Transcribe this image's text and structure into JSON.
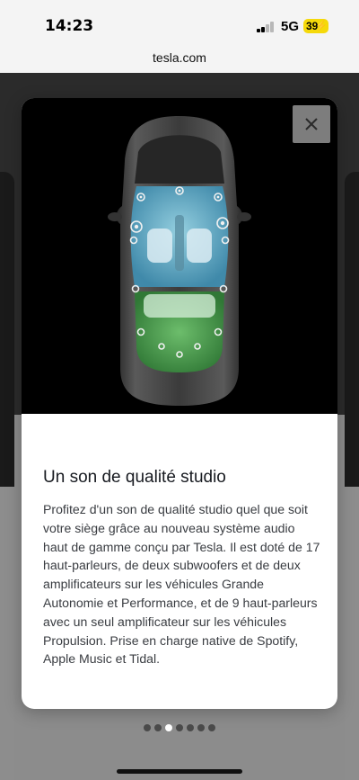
{
  "status_bar": {
    "time": "14:23",
    "network": "5G",
    "battery_level": "39",
    "signal_bars_active": 2
  },
  "browser": {
    "url": "tesla.com"
  },
  "modal": {
    "close_icon": "close-icon",
    "title": "Un son de qualité studio",
    "body": "Profitez d'un son de qualité studio quel que soit votre siège grâce au nouveau système audio haut de gamme conçu par Tesla. Il est doté de 17 haut-parleurs, de deux subwoofers et de deux amplificateurs sur les véhicules Grande Autonomie et Performance, et de 9 haut-parleurs avec un seul amplificateur sur les véhicules Propulsion. Prise en charge native de Spotify, Apple Music et Tidal."
  },
  "pagination": {
    "count": 7,
    "active_index": 2
  },
  "colors": {
    "battery": "#f5d90a",
    "front_zone": "#5fb8d8",
    "rear_zone": "#3f9a45"
  }
}
